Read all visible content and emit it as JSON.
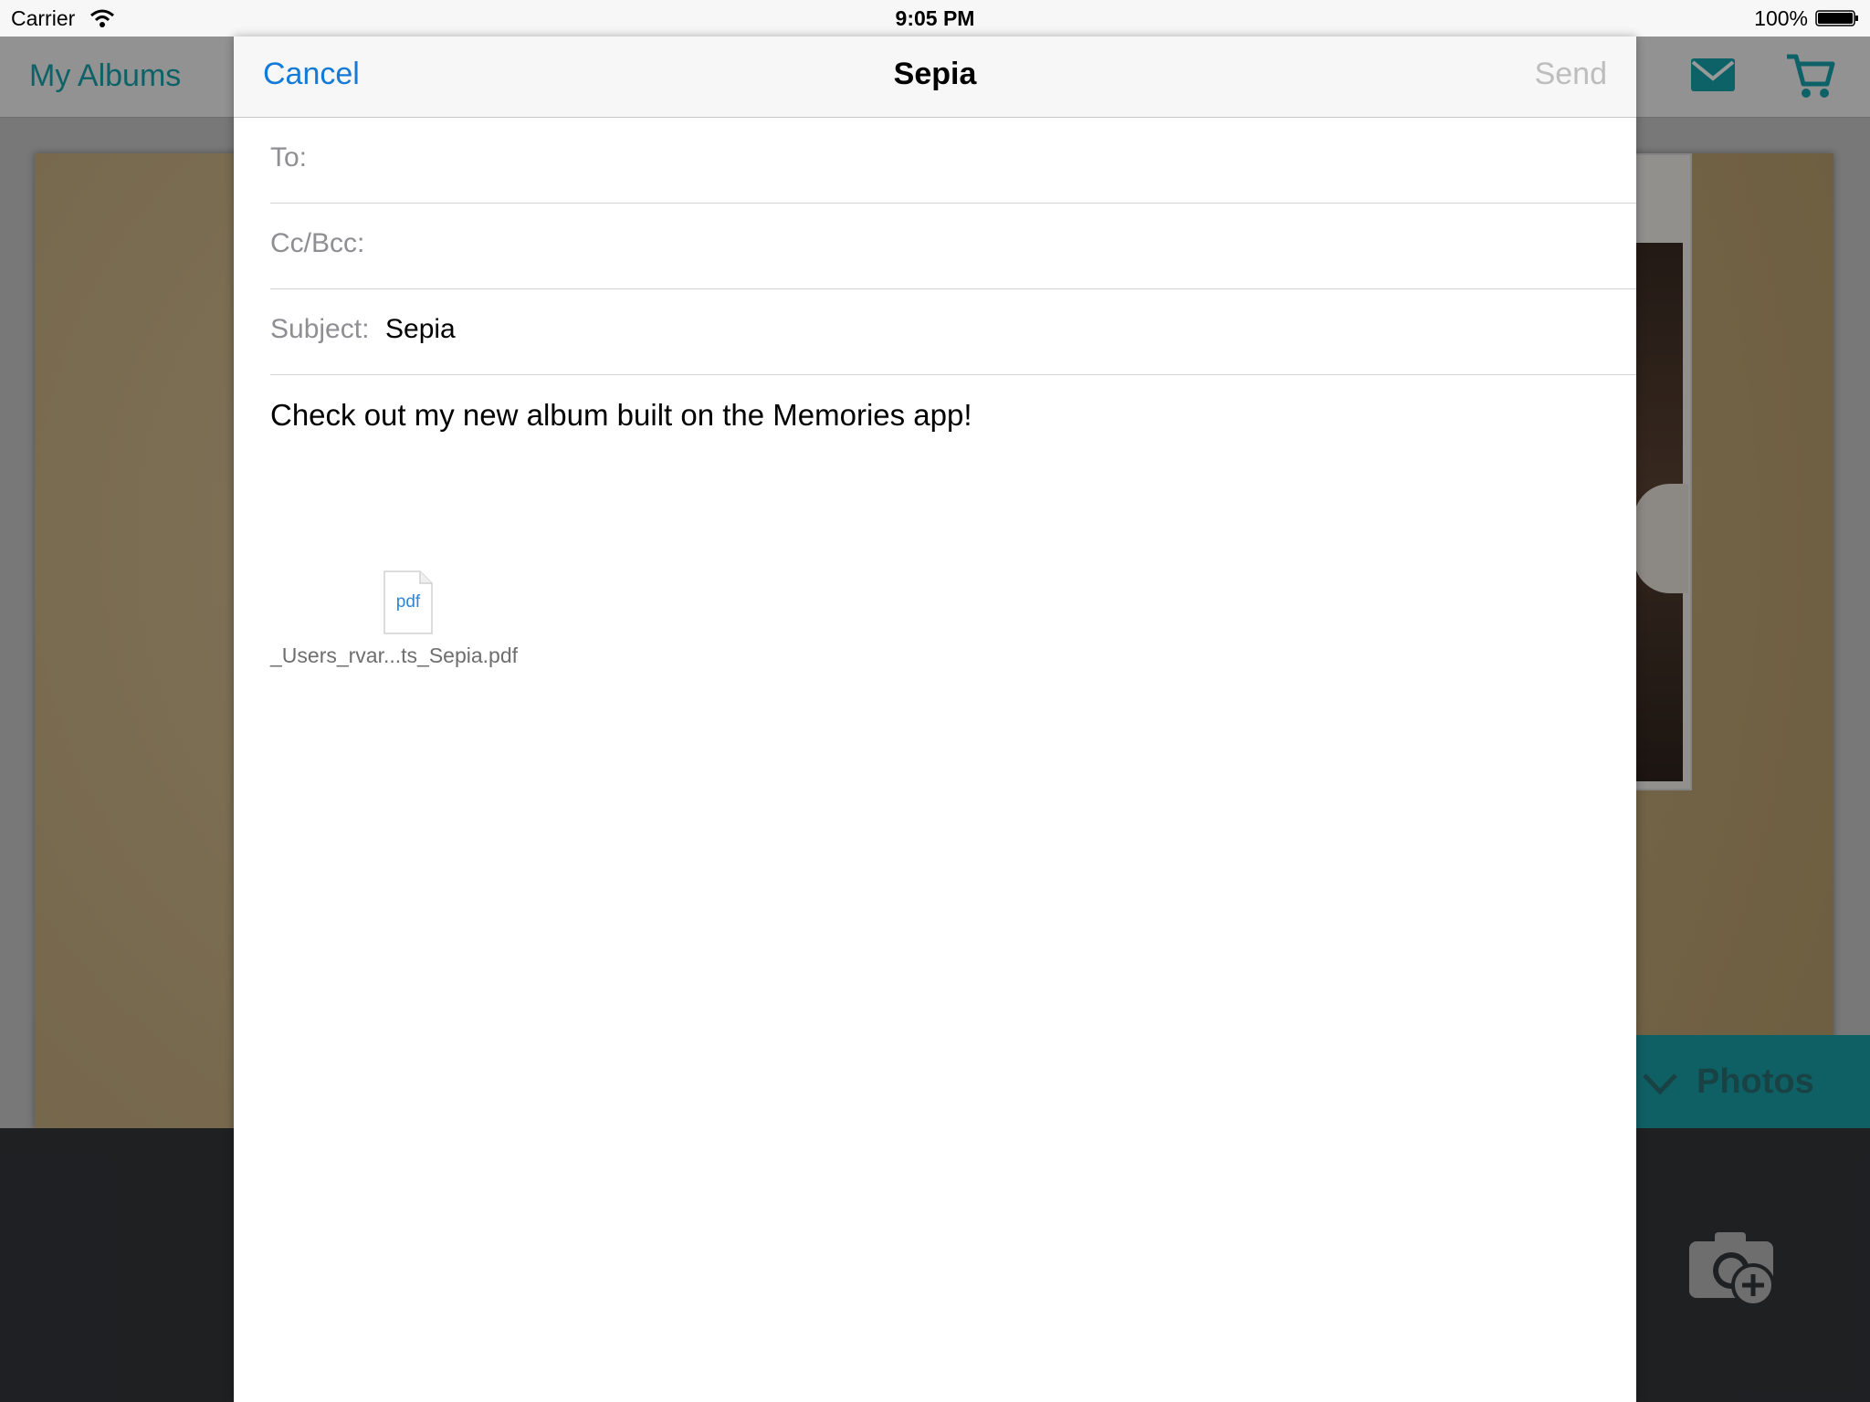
{
  "status_bar": {
    "carrier": "Carrier",
    "time": "9:05 PM",
    "battery": "100%"
  },
  "app": {
    "back_label": "My Albums",
    "photos_tab_label": "Photos",
    "accent_color": "#17a3ae"
  },
  "compose": {
    "title": "Sepia",
    "cancel_label": "Cancel",
    "send_label": "Send",
    "to_label": "To:",
    "to_value": "",
    "cc_label": "Cc/Bcc:",
    "cc_value": "",
    "subject_label": "Subject:",
    "subject_value": "Sepia",
    "body": "Check out my new album built on the Memories app!",
    "attachment": {
      "type_label": "pdf",
      "file_name": "_Users_rvar...ts_Sepia.pdf",
      "icon": "pdf-file-icon"
    },
    "link_color": "#137ad6"
  }
}
